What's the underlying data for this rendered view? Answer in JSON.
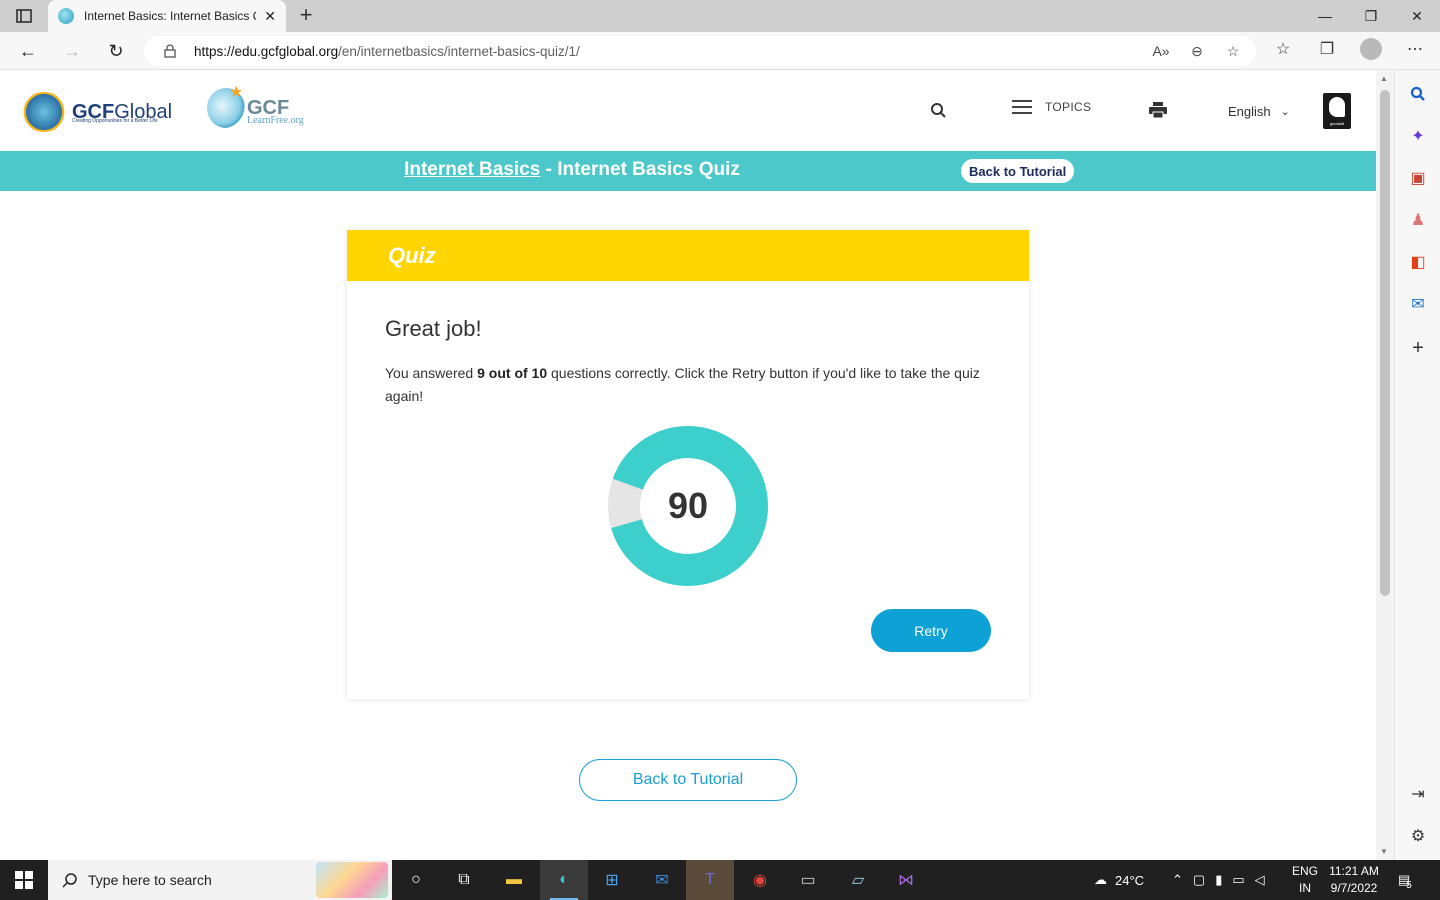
{
  "browser": {
    "tab_title": "Internet Basics: Internet Basics Q",
    "url_host": "https://edu.gcfglobal.org",
    "url_path": "/en/internetbasics/internet-basics-quiz/1/",
    "new_tab_symbol": "+",
    "window_controls": [
      "—",
      "❐",
      "✕"
    ]
  },
  "site_header": {
    "logo1_main": "GCF",
    "logo1_rest": "Global",
    "logo1_tagline": "Creating Opportunities for a Better Life",
    "logo2_main": "GCF",
    "logo2_sub": "LearnFree.org",
    "topics_label": "TOPICS",
    "language": "English",
    "goodwill_text": "goodwill"
  },
  "breadcrumb": {
    "tutorial_link": "Internet Basics",
    "separator": " - ",
    "page_title": "Internet Basics Quiz",
    "back_button": "Back to Tutorial"
  },
  "quiz": {
    "header": "Quiz",
    "heading": "Great job!",
    "result_prefix": "You answered ",
    "result_bold": "9 out of 10",
    "result_suffix": " questions correctly. Click the Retry button if you'd like to take the quiz again!",
    "score": "90",
    "score_percent": 90,
    "retry_label": "Retry",
    "colors": {
      "filled": "#3ccfcb",
      "empty": "#e5e5e5",
      "header": "#ffd500",
      "button": "#0ea1d5"
    }
  },
  "footer_button": "Back to Tutorial",
  "taskbar": {
    "search_placeholder": "Type here to search",
    "weather": "24°C",
    "lang_top": "ENG",
    "lang_bottom": "IN",
    "time": "11:21 AM",
    "date": "9/7/2022",
    "notification_count": "5"
  }
}
